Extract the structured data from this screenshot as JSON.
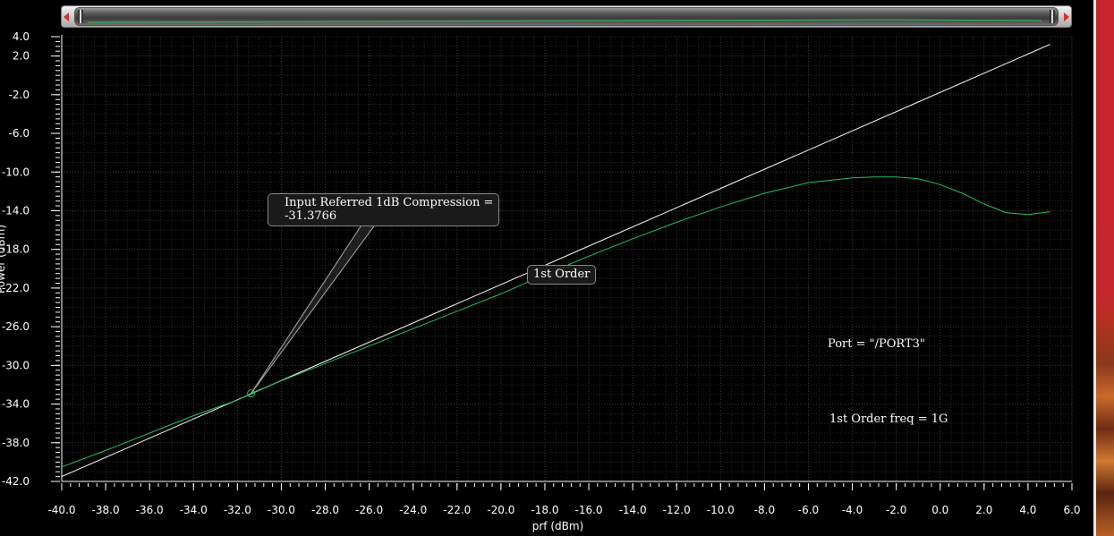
{
  "chart_data": {
    "type": "line",
    "xlabel": "prf (dBm)",
    "ylabel": "Power (dBm)",
    "xlim": [
      -40.0,
      6.0
    ],
    "ylim": [
      -42.0,
      4.0
    ],
    "x_ticks": [
      "-40.0",
      "-38.0",
      "-36.0",
      "-34.0",
      "-32.0",
      "-30.0",
      "-28.0",
      "-26.0",
      "-24.0",
      "-22.0",
      "-20.0",
      "-18.0",
      "-16.0",
      "-14.0",
      "-12.0",
      "-10.0",
      "-8.0",
      "-6.0",
      "-4.0",
      "-2.0",
      "0.0",
      "2.0",
      "4.0",
      "6.0"
    ],
    "y_ticks": [
      "4.0",
      "2.0",
      "-2.0",
      "-6.0",
      "-10.0",
      "-14.0",
      "-18.0",
      "-22.0",
      "-26.0",
      "-30.0",
      "-34.0",
      "-38.0",
      "-42.0"
    ],
    "grid": true,
    "series": [
      {
        "color": "#ffffff",
        "x": [
          -40.0,
          5.0
        ],
        "y": [
          -41.5,
          3.2
        ]
      },
      {
        "color": "#22c060",
        "x": [
          -40.0,
          -38.0,
          -36.0,
          -34.0,
          -32.0,
          -31.4,
          -30.0,
          -28.0,
          -26.0,
          -24.0,
          -22.0,
          -20.0,
          -18.0,
          -16.0,
          -14.0,
          -12.0,
          -10.0,
          -8.0,
          -6.0,
          -4.0,
          -3.0,
          -2.0,
          -1.0,
          0.0,
          1.0,
          2.0,
          3.0,
          4.0,
          5.0
        ],
        "y": [
          -40.5,
          -38.8,
          -37.0,
          -35.2,
          -33.6,
          -32.9,
          -31.6,
          -29.8,
          -28.0,
          -26.2,
          -24.4,
          -22.6,
          -20.6,
          -18.7,
          -16.9,
          -15.2,
          -13.6,
          -12.2,
          -11.1,
          -10.6,
          -10.5,
          -10.5,
          -10.7,
          -11.3,
          -12.2,
          -13.3,
          -14.2,
          -14.4,
          -14.1
        ]
      }
    ],
    "marker": {
      "x": -31.3766,
      "y": -32.9
    },
    "annotations": {
      "compression_line1": "Input Referred 1dB Compression =",
      "compression_line2": "-31.3766",
      "order_label": "1st Order",
      "port": "Port = \"/PORT3\"",
      "freq": "1st Order freq = 1G"
    }
  }
}
